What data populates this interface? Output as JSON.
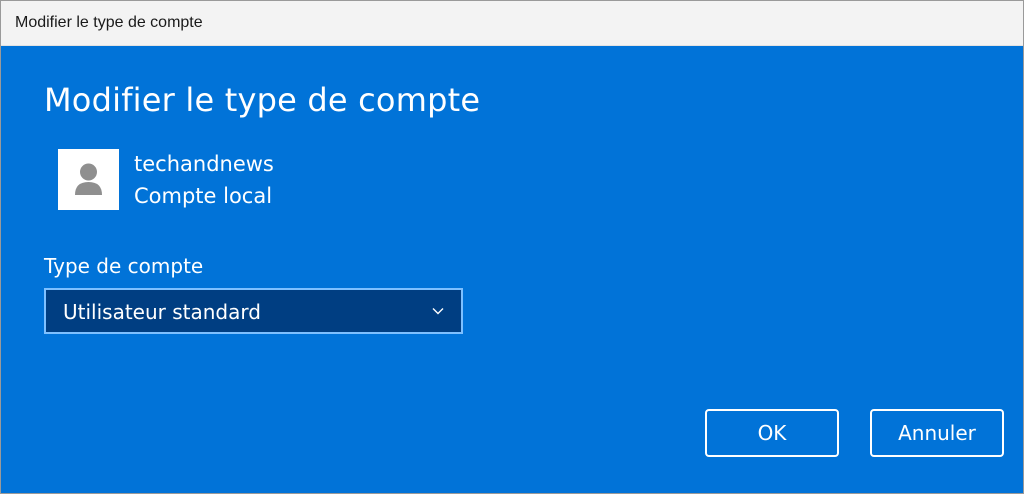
{
  "window": {
    "title": "Modifier le type de compte"
  },
  "dialog": {
    "heading": "Modifier le type de compte",
    "user": {
      "name": "techandnews",
      "account_kind": "Compte local",
      "avatar_icon": "person-icon"
    },
    "account_type": {
      "label": "Type de compte",
      "selected": "Utilisateur standard",
      "chevron_icon": "chevron-down-icon"
    },
    "buttons": {
      "ok": "OK",
      "cancel": "Annuler"
    }
  },
  "colors": {
    "dialog_background": "#0173d8",
    "select_background": "#003e82",
    "select_border": "#7ec0ff",
    "titlebar_background": "#f3f3f3",
    "text": "#ffffff"
  }
}
